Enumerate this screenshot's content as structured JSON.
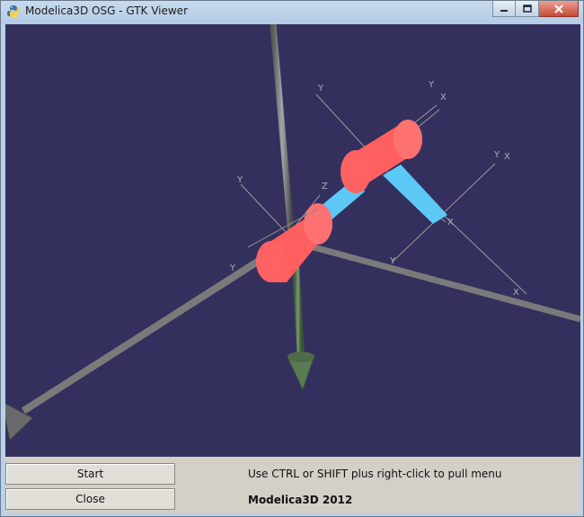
{
  "window": {
    "title": "Modelica3D OSG - GTK Viewer",
    "icon": "python-icon"
  },
  "titlebar_buttons": {
    "minimize_icon": "minimize-icon",
    "maximize_icon": "maximize-icon",
    "close_icon": "close-icon"
  },
  "viewport": {
    "background": "#33305e",
    "axis_labels": [
      "Y",
      "Y",
      "X",
      "X",
      "Y",
      "X",
      "Y",
      "Z",
      "Y",
      "X",
      "Y"
    ]
  },
  "controls": {
    "start_label": "Start",
    "close_label": "Close",
    "hint_text": "Use CTRL or SHIFT plus right-click to pull menu",
    "brand_text": "Modelica3D 2012"
  }
}
